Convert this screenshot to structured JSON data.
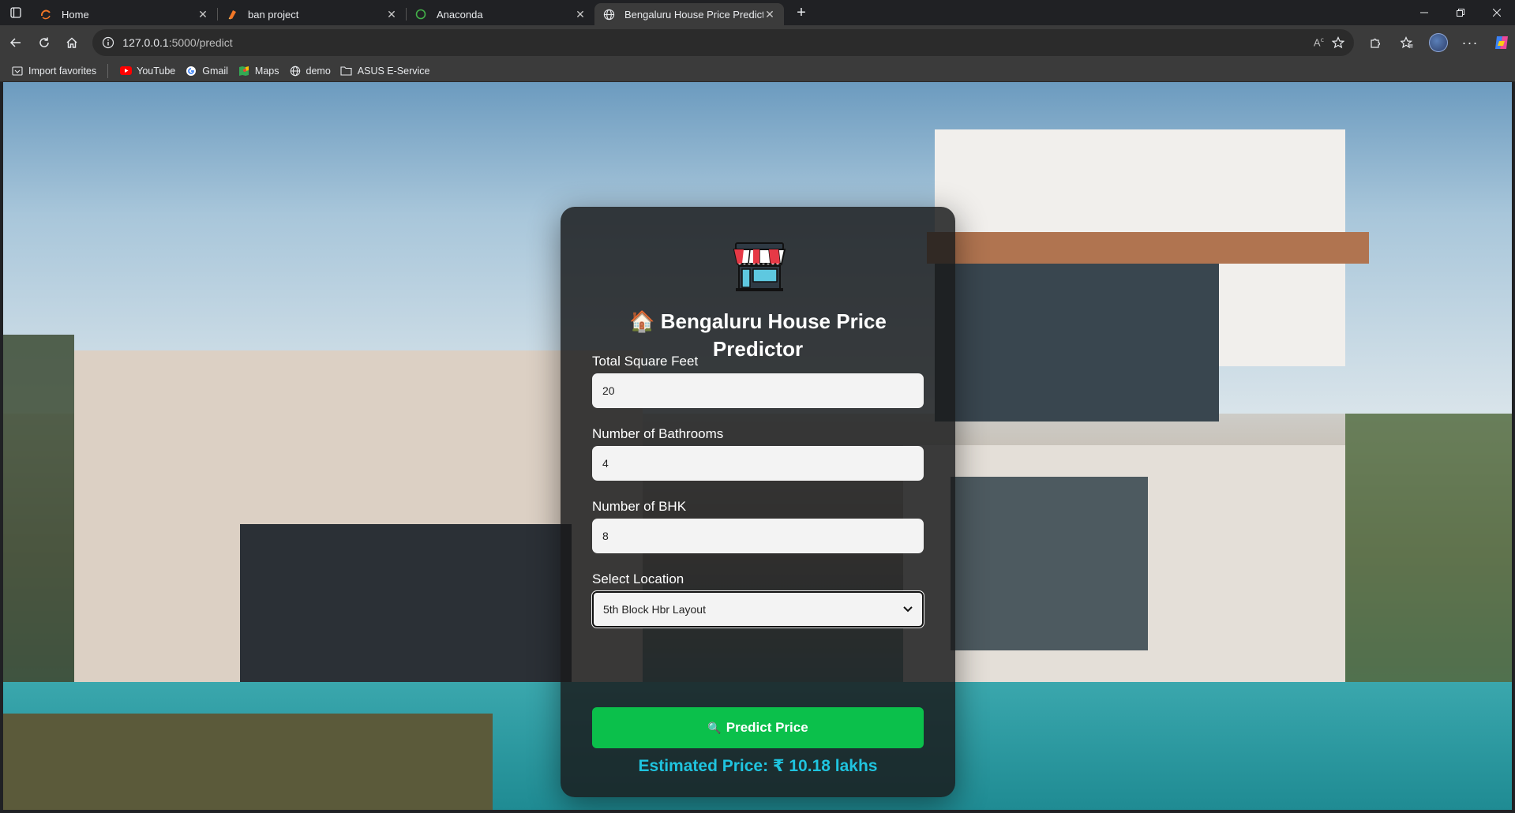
{
  "browser": {
    "tabs": [
      {
        "title": "Home",
        "icon": "circle-logo-icon",
        "active": false
      },
      {
        "title": "ban project",
        "icon": "notebook-icon",
        "active": false
      },
      {
        "title": "Anaconda",
        "icon": "anaconda-icon",
        "active": false
      },
      {
        "title": "Bengaluru House Price Predictor",
        "icon": "globe-icon",
        "active": true
      }
    ],
    "address": {
      "host": "127.0.0.1",
      "path": ":5000/predict"
    },
    "bookmarks": [
      {
        "label": "Import favorites",
        "icon": "import-icon"
      },
      {
        "label": "YouTube",
        "icon": "youtube-icon"
      },
      {
        "label": "Gmail",
        "icon": "google-icon"
      },
      {
        "label": "Maps",
        "icon": "maps-icon"
      },
      {
        "label": "demo",
        "icon": "globe-icon"
      },
      {
        "label": "ASUS E-Service",
        "icon": "folder-icon"
      }
    ]
  },
  "app": {
    "title_emoji": "🏠",
    "title": "Bengaluru House Price Predictor",
    "fields": {
      "sqft": {
        "label": "Total Square Feet",
        "value": "20"
      },
      "bath": {
        "label": "Number of Bathrooms",
        "value": "4"
      },
      "bhk": {
        "label": "Number of BHK",
        "value": "8"
      },
      "location": {
        "label": "Select Location",
        "value": "5th Block Hbr Layout"
      }
    },
    "predict_button": {
      "emoji": "🔍",
      "label": "Predict Price"
    },
    "result": "Estimated Price: ₹ 10.18 lakhs"
  },
  "colors": {
    "accent_green": "#0bc04b",
    "result_cyan": "#1fc4df",
    "card_bg": "rgba(25,26,28,0.84)"
  }
}
